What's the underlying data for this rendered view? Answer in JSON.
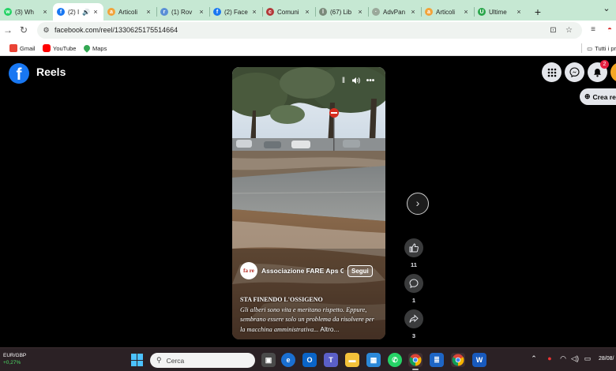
{
  "browser": {
    "tabs": [
      {
        "label": "(3) Wh",
        "favicon": "whatsapp-icon",
        "color": "#25d366",
        "glyph": "w"
      },
      {
        "label": "(2) I",
        "favicon": "facebook-icon",
        "color": "#1877f2",
        "glyph": "f",
        "active": true,
        "audio": true
      },
      {
        "label": "Articoli",
        "favicon": "blog-icon",
        "color": "#f2a33a",
        "glyph": "a"
      },
      {
        "label": "(1) Rov",
        "favicon": "bird-icon",
        "color": "#5b8fd6",
        "glyph": "r"
      },
      {
        "label": "(2) Face",
        "favicon": "facebook-icon",
        "color": "#1877f2",
        "glyph": "f"
      },
      {
        "label": "Comuni",
        "favicon": "crest-icon",
        "color": "#b33a3a",
        "glyph": "c"
      },
      {
        "label": "(67) Lib",
        "favicon": "globe-icon",
        "color": "#7a8a7a",
        "glyph": "l"
      },
      {
        "label": "AdvPan",
        "favicon": "chart-icon",
        "color": "#9aa89a",
        "glyph": "·"
      },
      {
        "label": "Articoli",
        "favicon": "blog-icon",
        "color": "#f2a33a",
        "glyph": "a"
      },
      {
        "label": "Ultime",
        "favicon": "news-icon",
        "color": "#2aa64b",
        "glyph": "U"
      }
    ],
    "new_tab": "+",
    "window_control": "⌄",
    "url": "facebook.com/reel/1330625175514664"
  },
  "bookmarks": {
    "items": [
      {
        "label": "Gmail",
        "color": "#ea4335"
      },
      {
        "label": "YouTube",
        "color": "#ff0000"
      },
      {
        "label": "Maps",
        "color": "#34a853"
      }
    ],
    "all": "Tutti i pr"
  },
  "facebook": {
    "logo": "f",
    "section_title": "Reels",
    "notification_count": "2",
    "create_button": "Crea re"
  },
  "reel": {
    "author_initials": "fa re",
    "author": "Associazione FARE Aps G",
    "follow_label": "Segui",
    "caption_title": "STA FINENDO L'OSSIGENO",
    "caption_body": "Gli alberi sono vita e meritano rispetto. Eppure, sembrano essere solo un problema da risolvere per la macchina amministrativa...",
    "more_label": "Altro...",
    "likes": "11",
    "comments": "1",
    "shares": "3"
  },
  "taskbar": {
    "ticker": "EUR/GBP",
    "ticker_change": "+0,27%",
    "search_placeholder": "Cerca",
    "clock": "28/08/"
  }
}
